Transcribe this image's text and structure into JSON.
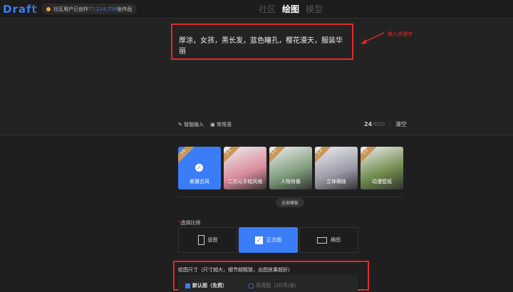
{
  "header": {
    "logo": "Draft",
    "community_prefix": "社区用户已创作",
    "community_count": "77,214,759",
    "community_suffix": "张作品",
    "nav": [
      "社区",
      "绘图",
      "模型"
    ],
    "active_nav": "绘图"
  },
  "prompt": {
    "value": "厚涂，女孩，黑长发，蓝色瞳孔，樱花漫天，服装华丽",
    "annotation": "输入关键字"
  },
  "tools": {
    "smart_input": "智能输入",
    "common_words": "常用语",
    "count": "24",
    "max": "/600",
    "clear": "清空"
  },
  "templates": {
    "items": [
      {
        "label": "柔雅古风",
        "badge": "1.0",
        "color": "#3b7df6"
      },
      {
        "label": "二次元手绘风格",
        "badge": "1.0",
        "color": "#d98a9a"
      },
      {
        "label": "人物肖像",
        "badge": "1.0",
        "color": "#7d9a7a"
      },
      {
        "label": "立体萌娃",
        "badge": "1.0",
        "color": "#9a9aa8"
      },
      {
        "label": "动漫壁纸",
        "badge": "1.0",
        "color": "#6f8a4c"
      }
    ],
    "all_label": "全部模板"
  },
  "ratio": {
    "title": "选择比例",
    "options": [
      "竖图",
      "正方图",
      "横图"
    ],
    "selected": "正方图"
  },
  "size": {
    "title": "绘图尺寸（尺寸越大，细节越精致，出图效果越好）",
    "options": [
      "默认图（免费）",
      "高清图（2D币/张）"
    ],
    "selected": "默认图（免费）"
  }
}
